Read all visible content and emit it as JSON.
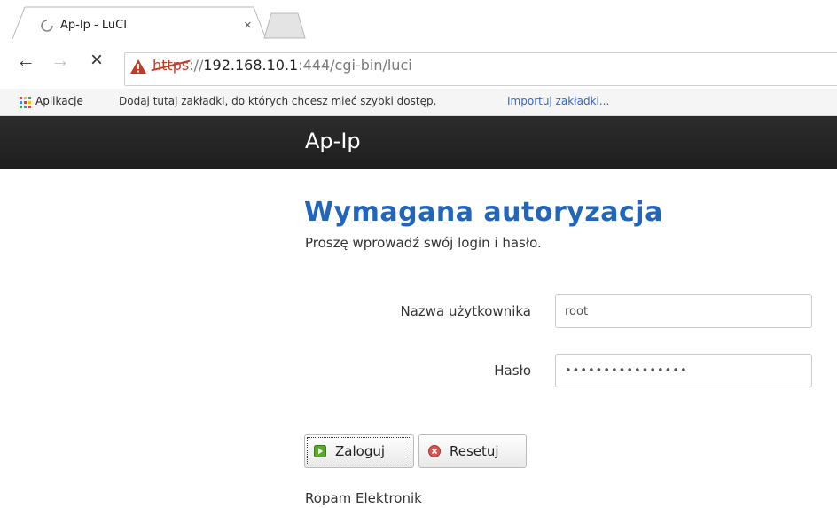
{
  "browser": {
    "tab": {
      "title": "Ap-Ip - LuCI",
      "close_symbol": "×",
      "loading_icon": "spinner-icon"
    },
    "toolbar": {
      "back_symbol": "←",
      "forward_symbol": "→",
      "stop_symbol": "×"
    },
    "address": {
      "scheme": "https",
      "scheme_suffix": "://",
      "host": "192.168.10.1",
      "rest": ":444/cgi-bin/luci",
      "security_icon": "warning-icon"
    },
    "bookmarks": {
      "apps_label": "Aplikacje",
      "hint": "Dodaj tutaj zakładki, do których chcesz mieć szybki dostęp.",
      "import_link": "Importuj zakładki..."
    }
  },
  "header": {
    "brand": "Ap-Ip"
  },
  "login": {
    "title": "Wymagana autoryzacja",
    "subtitle": "Proszę wprowadź swój login i hasło.",
    "username_label": "Nazwa użytkownika",
    "username_value": "root",
    "password_label": "Hasło",
    "password_value": "••••••••••••••••",
    "login_button": "Zaloguj",
    "reset_button": "Resetuj"
  },
  "footer": {
    "text": "Ropam Elektronik"
  },
  "colors": {
    "heading": "#2266bb",
    "header_bg": "#222222",
    "warning": "#c53929",
    "link": "#3366cc"
  }
}
